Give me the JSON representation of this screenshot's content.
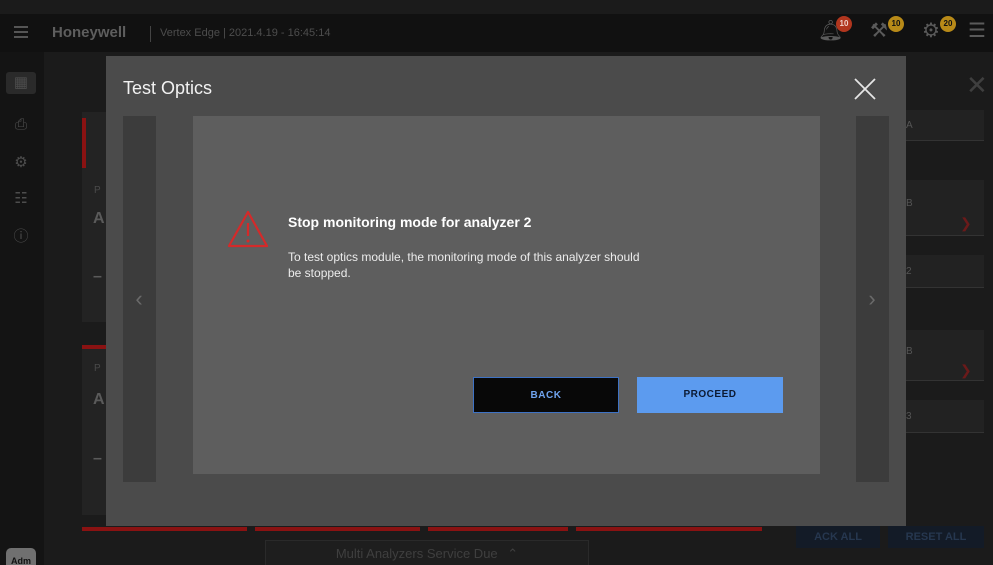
{
  "header": {
    "brand": "Honeywell",
    "subtitle": "Vertex Edge | 2021.4.19 - 16:45:14",
    "alarm_badge": "10",
    "maintenance_badge": "10",
    "service_badge": "20"
  },
  "sidebar": {
    "avatar_label": "Adm"
  },
  "background": {
    "card_letter": "A",
    "card_small": "P",
    "dash": "–",
    "right_labels": [
      "A",
      "B",
      "2",
      "B",
      "3"
    ],
    "ack_all": "ACK ALL",
    "reset_all": "RESET ALL",
    "service_bar": "Multi Analyzers Service Due"
  },
  "modal": {
    "title": "Test Optics",
    "dialog": {
      "heading": "Stop monitoring mode for analyzer 2",
      "body": "To test optics module, the monitoring mode of this analyzer should be stopped.",
      "back_label": "BACK",
      "proceed_label": "PROCEED"
    }
  },
  "colors": {
    "accent": "#5c9bef",
    "warning": "#d42a2a",
    "badge": "#b88a18"
  }
}
